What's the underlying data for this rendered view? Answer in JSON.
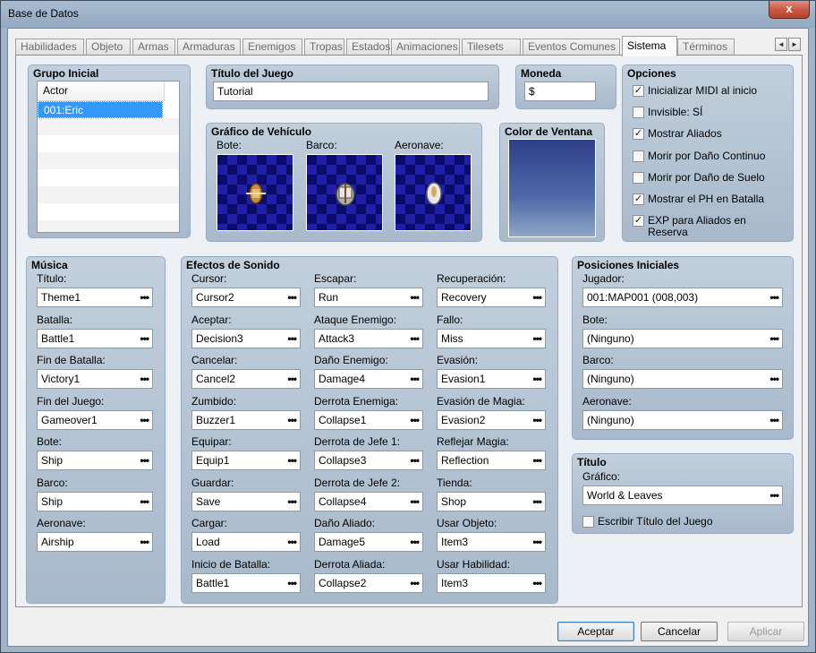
{
  "window": {
    "title": "Base de Datos",
    "close_glyph": "x"
  },
  "tabs": [
    {
      "label": "Habilidades"
    },
    {
      "label": "Objeto"
    },
    {
      "label": "Armas"
    },
    {
      "label": "Armaduras"
    },
    {
      "label": "Enemigos"
    },
    {
      "label": "Tropas"
    },
    {
      "label": "Estados"
    },
    {
      "label": "Animaciones"
    },
    {
      "label": "Tilesets"
    },
    {
      "label": "Eventos Comunes"
    },
    {
      "label": "Sistema"
    },
    {
      "label": "Términos"
    }
  ],
  "active_tab": "Sistema",
  "tab_arrows": {
    "left": "◄",
    "right": "►"
  },
  "grupo_inicial": {
    "title": "Grupo Inicial",
    "column_header": "Actor",
    "items": [
      "001:Eric"
    ]
  },
  "titulo_juego": {
    "title": "Título del Juego",
    "value": "Tutorial"
  },
  "moneda": {
    "title": "Moneda",
    "value": "$"
  },
  "opciones": {
    "title": "Opciones",
    "items": [
      {
        "label": "Inicializar MIDI al inicio",
        "checked": true
      },
      {
        "label": "Invisible: SÍ",
        "checked": false
      },
      {
        "label": "Mostrar Aliados",
        "checked": true
      },
      {
        "label": "Morir por Daño Continuo",
        "checked": false
      },
      {
        "label": "Morir por Daño de Suelo",
        "checked": false
      },
      {
        "label": "Mostrar el PH en Batalla",
        "checked": true
      },
      {
        "label": "EXP para Aliados en",
        "label2": "Reserva",
        "checked": true
      }
    ],
    "check_glyph": "✓"
  },
  "grafico_vehiculo": {
    "title": "Gráfico de Vehículo",
    "labels": [
      "Bote:",
      "Barco:",
      "Aeronave:"
    ]
  },
  "color_ventana": {
    "title": "Color de Ventana"
  },
  "musica": {
    "title": "Música",
    "items": [
      {
        "label": "Título:",
        "value": "Theme1"
      },
      {
        "label": "Batalla:",
        "value": "Battle1"
      },
      {
        "label": "Fin de Batalla:",
        "value": "Victory1"
      },
      {
        "label": "Fin del Juego:",
        "value": "Gameover1"
      },
      {
        "label": "Bote:",
        "value": "Ship"
      },
      {
        "label": "Barco:",
        "value": "Ship"
      },
      {
        "label": "Aeronave:",
        "value": "Airship"
      }
    ]
  },
  "efectos": {
    "title": "Efectos de Sonido",
    "col1": [
      {
        "label": "Cursor:",
        "value": "Cursor2"
      },
      {
        "label": "Aceptar:",
        "value": "Decision3"
      },
      {
        "label": "Cancelar:",
        "value": "Cancel2"
      },
      {
        "label": "Zumbido:",
        "value": "Buzzer1"
      },
      {
        "label": "Equipar:",
        "value": "Equip1"
      },
      {
        "label": "Guardar:",
        "value": "Save"
      },
      {
        "label": "Cargar:",
        "value": "Load"
      },
      {
        "label": "Inicio de Batalla:",
        "value": "Battle1"
      }
    ],
    "col2": [
      {
        "label": "Escapar:",
        "value": "Run"
      },
      {
        "label": "Ataque Enemigo:",
        "value": "Attack3"
      },
      {
        "label": "Daño Enemigo:",
        "value": "Damage4"
      },
      {
        "label": "Derrota Enemiga:",
        "value": "Collapse1"
      },
      {
        "label": "Derrota de Jefe 1:",
        "value": "Collapse3"
      },
      {
        "label": "Derrota de Jefe 2:",
        "value": "Collapse4"
      },
      {
        "label": "Daño Aliado:",
        "value": "Damage5"
      },
      {
        "label": "Derrota Aliada:",
        "value": "Collapse2"
      }
    ],
    "col3": [
      {
        "label": "Recuperación:",
        "value": "Recovery"
      },
      {
        "label": "Fallo:",
        "value": "Miss"
      },
      {
        "label": "Evasión:",
        "value": "Evasion1"
      },
      {
        "label": "Evasión de Magia:",
        "value": "Evasion2"
      },
      {
        "label": "Reflejar Magia:",
        "value": "Reflection"
      },
      {
        "label": "Tienda:",
        "value": "Shop"
      },
      {
        "label": "Usar Objeto:",
        "value": "Item3"
      },
      {
        "label": "Usar Habilidad:",
        "value": "Item3"
      }
    ]
  },
  "posiciones": {
    "title": "Posiciones Iniciales",
    "items": [
      {
        "label": "Jugador:",
        "value": "001:MAP001 (008,003)"
      },
      {
        "label": "Bote:",
        "value": "(Ninguno)"
      },
      {
        "label": "Barco:",
        "value": "(Ninguno)"
      },
      {
        "label": "Aeronave:",
        "value": "(Ninguno)"
      }
    ]
  },
  "titulo": {
    "title": "Título",
    "grafico_label": "Gráfico:",
    "grafico_value": "World & Leaves",
    "check_label": "Escribir Título del Juego",
    "checked": false
  },
  "combo_glyph": "•••",
  "buttons": {
    "ok": "Aceptar",
    "cancel": "Cancelar",
    "apply": "Aplicar"
  }
}
